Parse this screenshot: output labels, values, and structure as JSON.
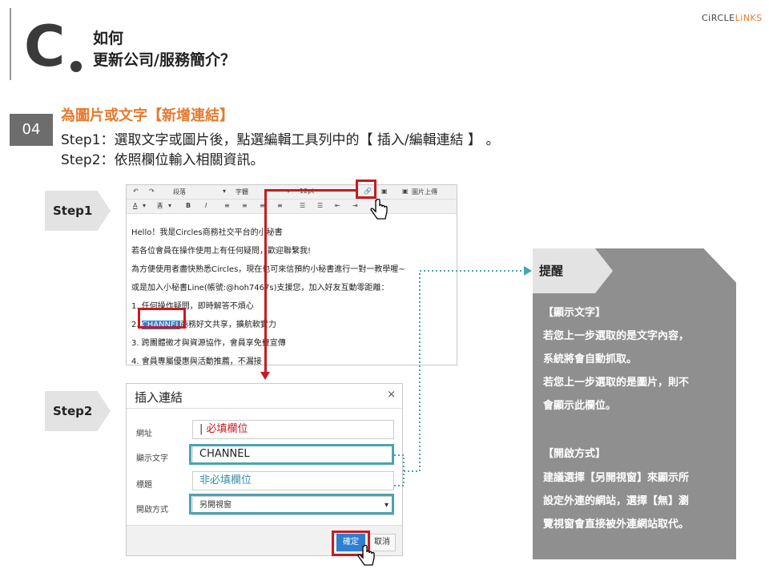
{
  "header": {
    "letter": "C",
    "title_line1": "如何",
    "title_line2": "更新公司/服務簡介？",
    "brand_prefix": "CiRCLE",
    "brand_suffix": "LiNKS"
  },
  "section": {
    "number": "04",
    "title": "為圖片或文字【新增連結】",
    "step1_text": "Step1：選取文字或圖片後，點選編輯工具列中的【 插入/編輯連結 】 。",
    "step2_text": "Step2：依照欄位輸入相關資訊。"
  },
  "tags": {
    "step1": "Step1",
    "step2": "Step2",
    "tip": "提醒"
  },
  "editor": {
    "toolbar1": {
      "paragraph": "段落",
      "font": "字體",
      "size": "12pt",
      "image_upload": "圖片上傳"
    },
    "toolbar2": {
      "bold": "B",
      "italic": "I",
      "font_color": "A",
      "bg_color": "A"
    },
    "lines": [
      "Hello！我是Circles商務社交平台的小秘書",
      "若各位會員在操作使用上有任何疑問，歡迎聯繫我!",
      "為方便使用者盡快熟悉Circles，現在也可來信預約小秘書進行一對一教學喔~",
      "或是加入小秘書Line(帳號:@hoh7467s)支援您，加入好友互動零距離：",
      "1. 任何操作疑問，即時解答不煩心",
      "2. ",
      "3. 跨團體徵才與資源協作，會員享免費宣傳",
      "4. 會員專屬優惠與活動推薦，不漏接"
    ],
    "line6_selected": "CHANNEL",
    "line6_rest": "商務好文共享，擴航軟實力"
  },
  "dialog": {
    "title": "插入連結",
    "close": "×",
    "fields": [
      {
        "label": "網址",
        "value": "必填欄位"
      },
      {
        "label": "顯示文字",
        "value": "CHANNEL"
      },
      {
        "label": "標題",
        "value": "非必填欄位"
      },
      {
        "label": "開啟方式",
        "value": "另開視窗"
      }
    ],
    "ok": "確定",
    "cancel": "取消"
  },
  "tip": {
    "heading1": "【顯示文字】",
    "lines1": [
      "若您上一步選取的是文字內容，",
      "系統將會自動抓取。",
      "若您上一步選取的是圖片，則不",
      "會顯示此欄位。"
    ],
    "heading2": "【開啟方式】",
    "lines2": [
      "建議選擇【另開視窗】來顯示所",
      "設定外連的網站，選擇【無】瀏",
      "覽視窗會直接被外連網站取代。"
    ]
  },
  "colors": {
    "accent": "#e67a2e",
    "highlight_red": "#c61b21",
    "teal": "#4aa3b3",
    "panel_gray": "#8f8f8f"
  }
}
